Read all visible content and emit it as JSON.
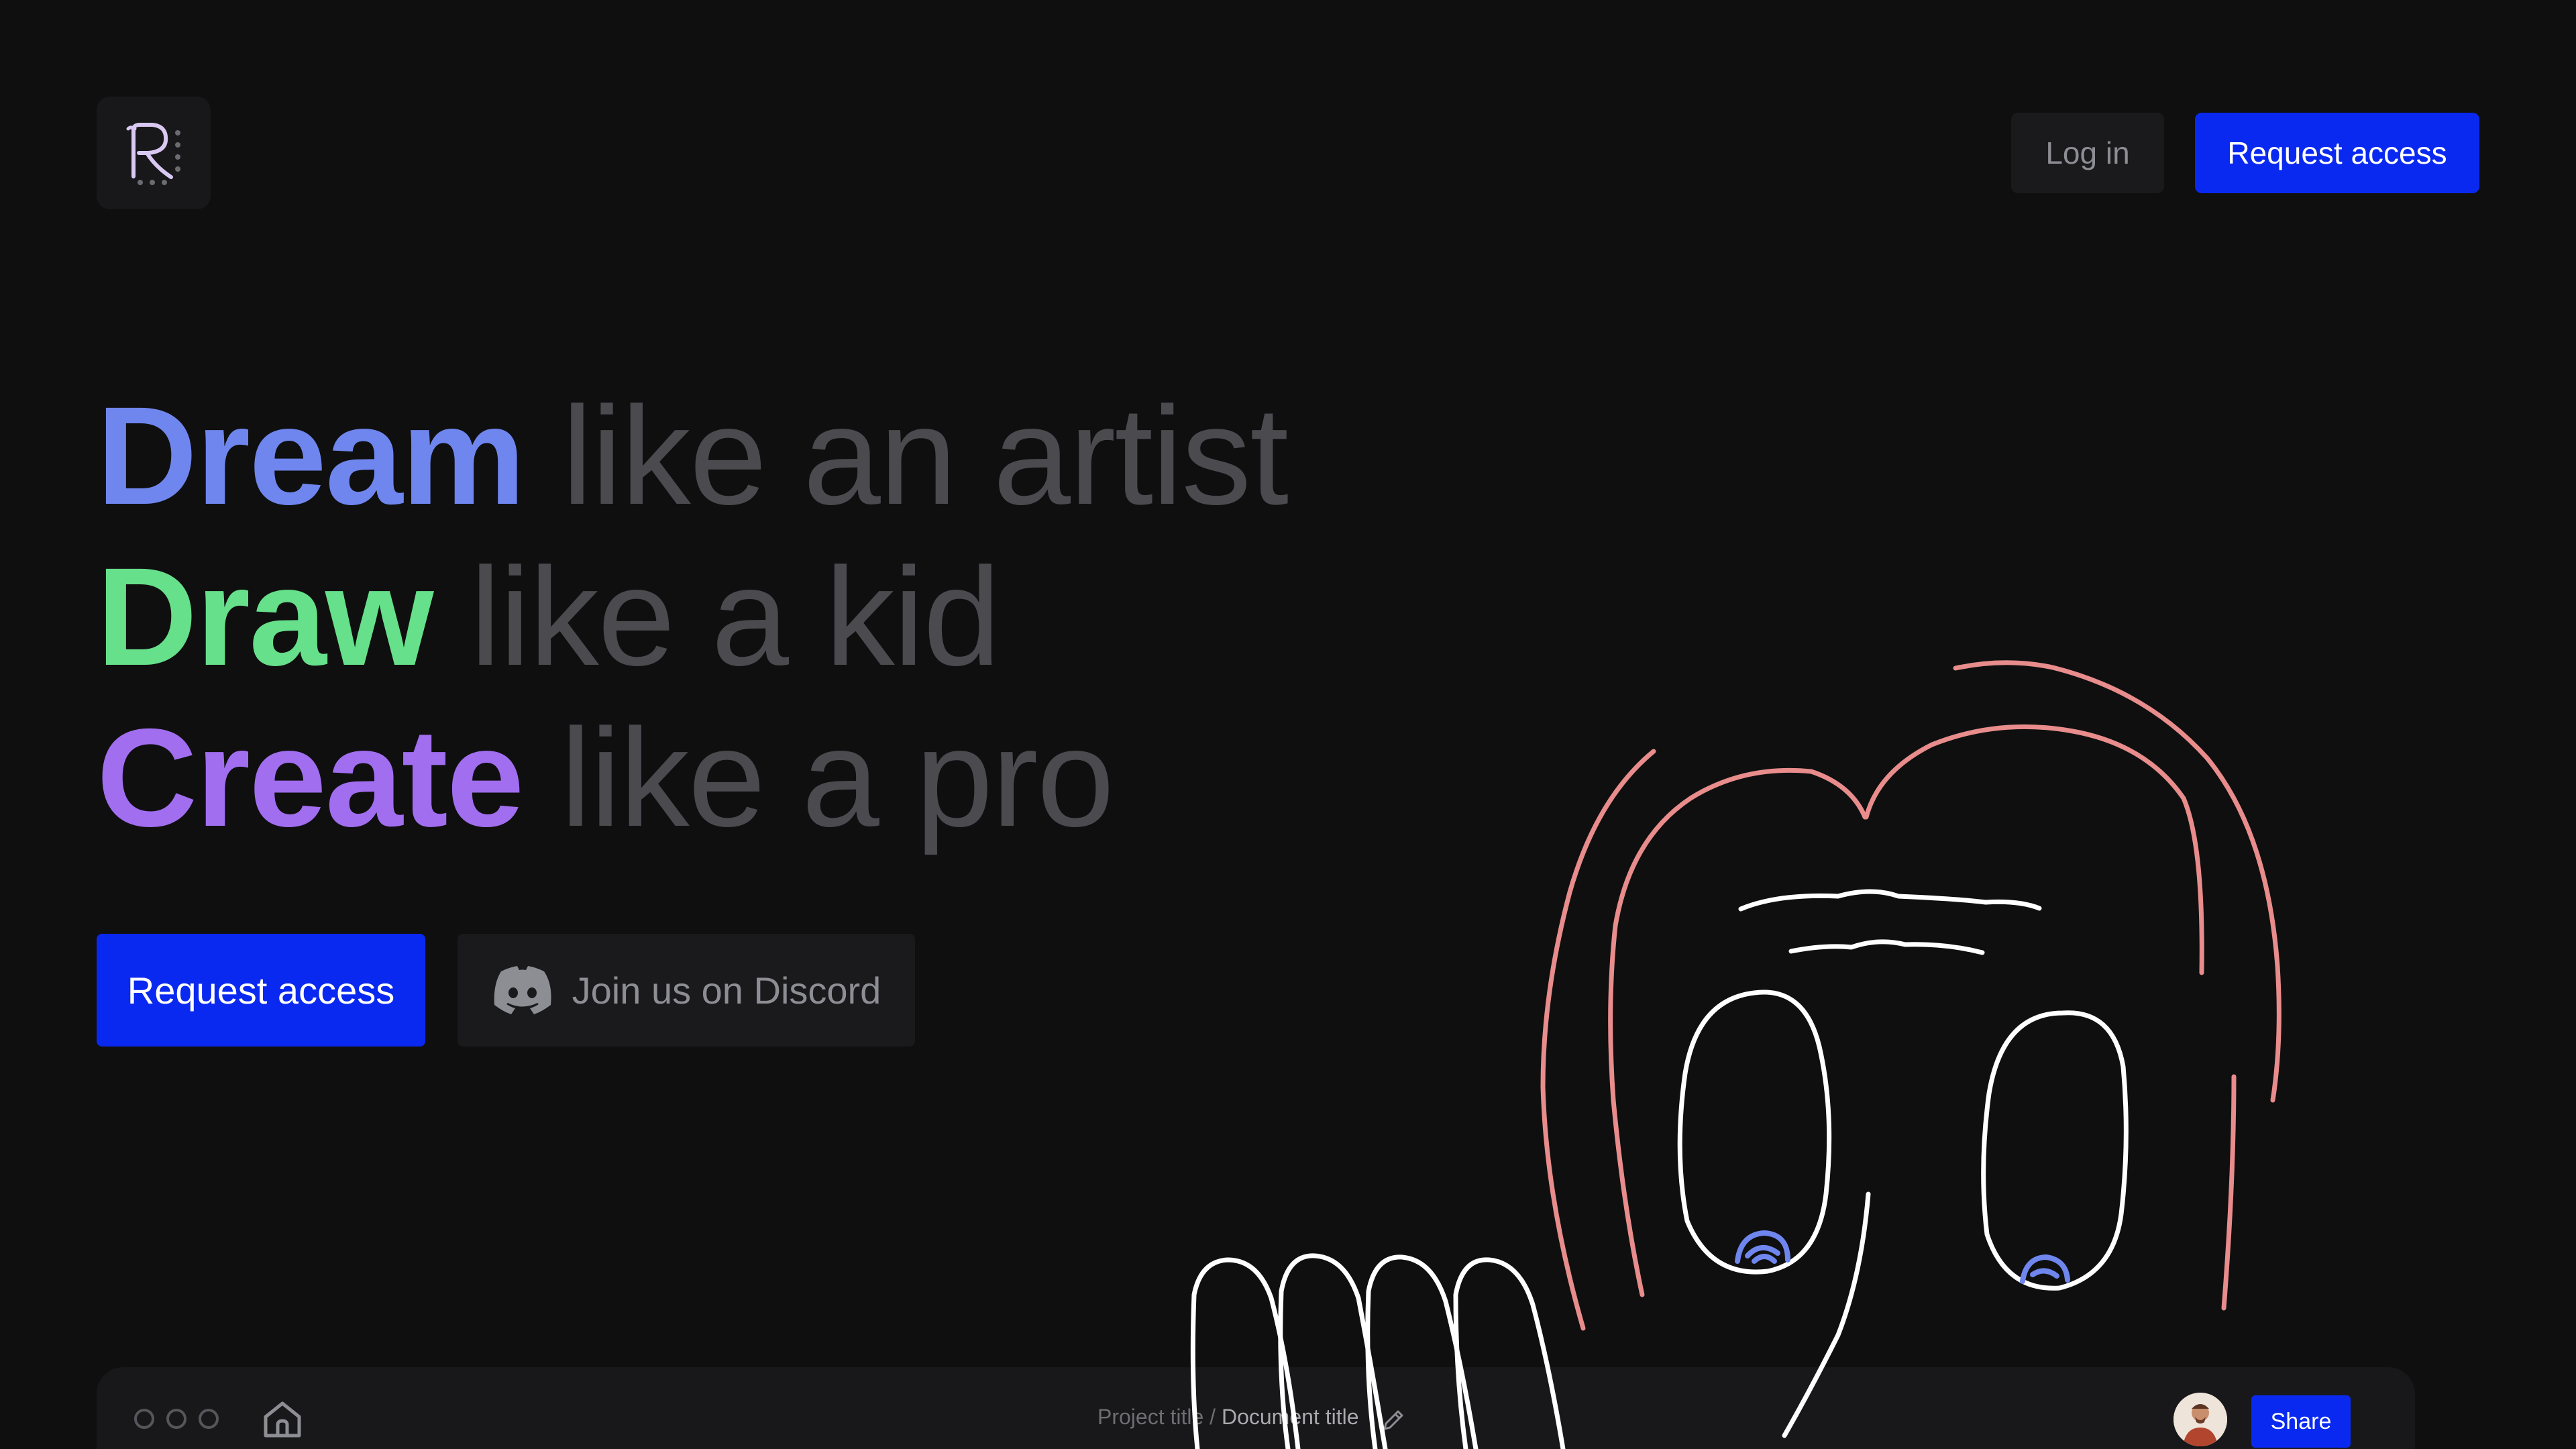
{
  "header": {
    "logo_alt": "R",
    "login_label": "Log in",
    "request_label": "Request access"
  },
  "hero": {
    "lines": [
      {
        "strong": "Dream",
        "muted": "like an artist",
        "color": "#6f86ee"
      },
      {
        "strong": "Draw",
        "muted": "like a kid",
        "color": "#66e08a"
      },
      {
        "strong": "Create",
        "muted": "like a pro",
        "color": "#a16ef0"
      }
    ]
  },
  "cta": {
    "request_label": "Request access",
    "discord_label": "Join us on Discord"
  },
  "app_preview": {
    "project_title": "Project title",
    "separator": "/",
    "document_title": "Document title",
    "share_label": "Share"
  },
  "colors": {
    "background": "#0f0f10",
    "accent_blue": "#0a29f0",
    "muted_text": "#4a4a4f",
    "sketch_hair": "#e88c8c",
    "sketch_face": "#ffffff",
    "sketch_pupil": "#6f86ee"
  },
  "icons": {
    "logo": "r-logo-icon",
    "discord": "discord-icon",
    "home": "home-icon",
    "pencil": "pencil-icon"
  }
}
